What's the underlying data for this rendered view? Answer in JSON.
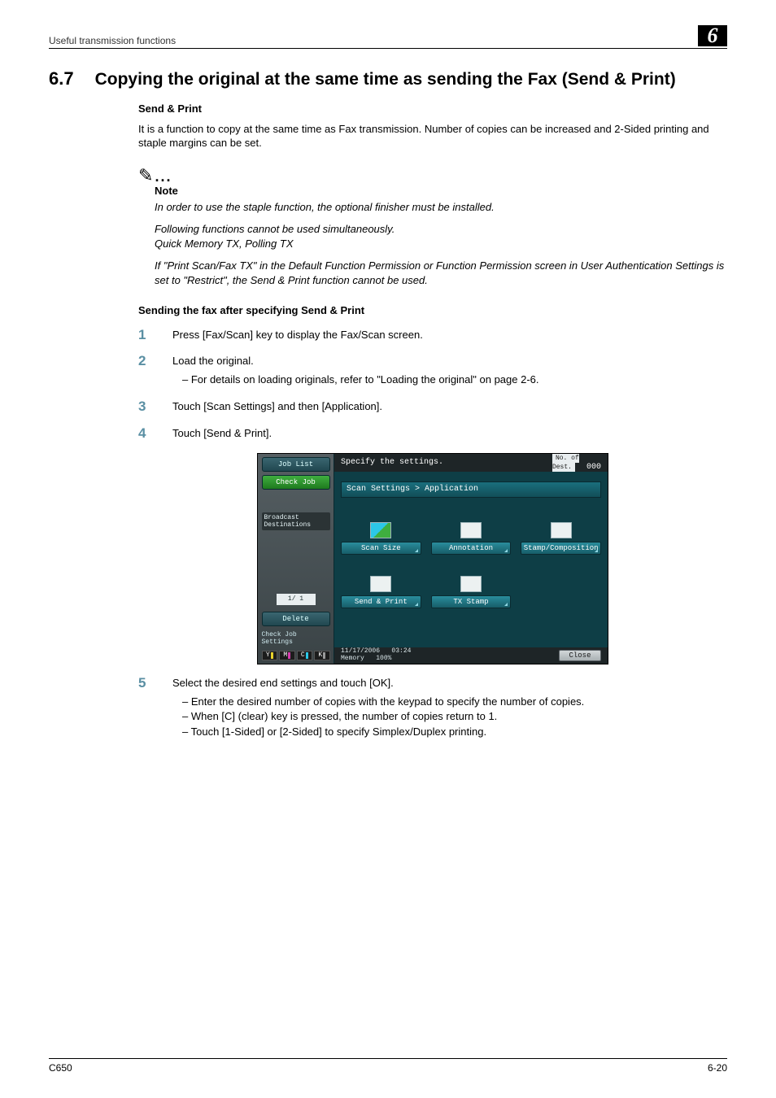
{
  "header": {
    "running_head": "Useful transmission functions",
    "chapter_indicator": "6"
  },
  "section": {
    "number": "6.7",
    "title": "Copying the original at the same time as sending the Fax (Send & Print)"
  },
  "intro": {
    "subtitle": "Send & Print",
    "text": "It is a function to copy at the same time as Fax transmission. Number of copies can be increased and 2-Sided printing and staple margins can be set."
  },
  "note": {
    "label": "Note",
    "paragraphs": [
      "In order to use the staple function, the optional finisher must be installed.",
      "Following functions cannot be used simultaneously.\nQuick Memory TX, Polling TX",
      "If \"Print Scan/Fax TX\" in the Default Function Permission or Function Permission screen in User Authentication Settings is set to \"Restrict\", the Send & Print function cannot be used."
    ]
  },
  "procedure": {
    "heading": "Sending the fax after specifying Send & Print",
    "steps": [
      {
        "n": "1",
        "text": "Press [Fax/Scan] key to display the Fax/Scan screen.",
        "bullets": []
      },
      {
        "n": "2",
        "text": "Load the original.",
        "bullets": [
          "For details on loading originals, refer to \"Loading the original\" on page 2-6."
        ]
      },
      {
        "n": "3",
        "text": "Touch [Scan Settings] and then [Application].",
        "bullets": []
      },
      {
        "n": "4",
        "text": "Touch [Send & Print].",
        "bullets": []
      },
      {
        "n": "5",
        "text": "Select the desired end settings and touch [OK].",
        "bullets": [
          "Enter the desired number of copies with the keypad to specify the number of copies.",
          "When [C] (clear) key is pressed, the number of copies return to 1.",
          "Touch [1-Sided] or [2-Sided] to specify Simplex/Duplex printing."
        ]
      }
    ]
  },
  "screenshot": {
    "sidebar": {
      "job_list": "Job List",
      "check_job": "Check Job",
      "broadcast_label": "Broadcast\nDestinations",
      "page_indicator": "1/  1",
      "delete": "Delete",
      "check_job_settings": "Check Job\nSettings",
      "toner_y": "Y",
      "toner_m": "M",
      "toner_c": "C",
      "toner_k": "K"
    },
    "main": {
      "top_instruction": "Specify the settings.",
      "dest_label": "No. of\nDest.",
      "dest_value": "000",
      "breadcrumb": "Scan Settings > Application",
      "apps": {
        "scan_size": "Scan Size",
        "annotation": "Annotation",
        "stamp_composition": "Stamp/Composition",
        "send_print": "Send & Print",
        "tx_stamp": "TX Stamp"
      },
      "datetime_date": "11/17/2006",
      "datetime_time": "03:24",
      "memory_label": "Memory",
      "memory_value": "100%",
      "close": "Close"
    }
  },
  "footer": {
    "left": "C650",
    "right": "6-20"
  }
}
